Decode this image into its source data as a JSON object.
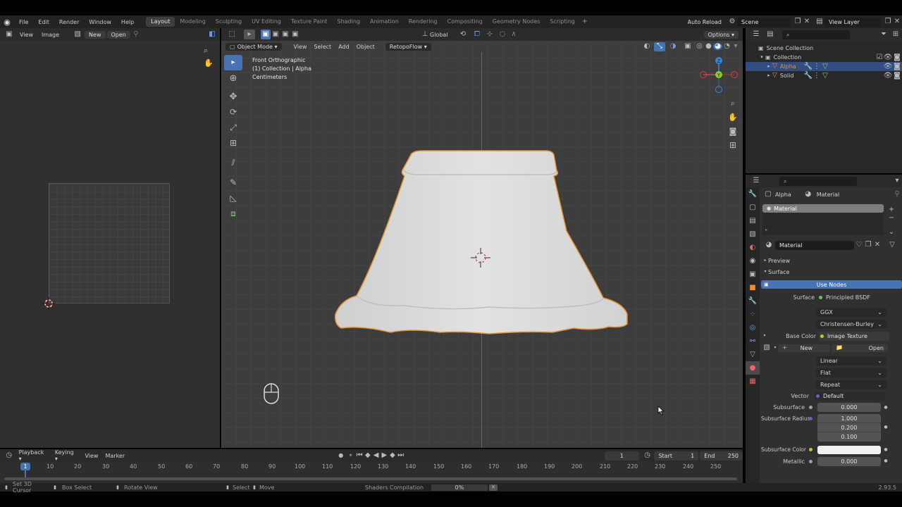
{
  "topbar": {
    "menus": [
      "File",
      "Edit",
      "Render",
      "Window",
      "Help"
    ],
    "workspaces": [
      "Layout",
      "Modeling",
      "Sculpting",
      "UV Editing",
      "Texture Paint",
      "Shading",
      "Animation",
      "Rendering",
      "Compositing",
      "Geometry Nodes",
      "Scripting"
    ],
    "active_workspace": "Layout",
    "auto_reload": "Auto Reload",
    "scene": "Scene",
    "view_layer": "View Layer"
  },
  "image_editor": {
    "menus": [
      "View",
      "Image"
    ],
    "new_label": "New",
    "open_label": "Open"
  },
  "viewport": {
    "header": {
      "transform_orientation": "Global",
      "options_label": "Options",
      "mode": "Object Mode",
      "menus": [
        "View",
        "Select",
        "Add",
        "Object"
      ],
      "addon_menu": "RetopoFlow"
    },
    "overlay_text": {
      "view_name": "Front Orthographic",
      "collection": "(1) Collection | Alpha",
      "units": "Centimeters"
    },
    "gizmo_axes": [
      "X",
      "Y",
      "Z"
    ]
  },
  "outliner": {
    "root": "Scene Collection",
    "collection": "Collection",
    "objects": [
      {
        "name": "Alpha",
        "selected": true
      },
      {
        "name": "Solid",
        "selected": false
      }
    ]
  },
  "properties": {
    "breadcrumb": {
      "object": "Alpha",
      "material": "Material"
    },
    "slot_name": "Material",
    "material_name": "Material",
    "sections": {
      "preview": "Preview",
      "surface": "Surface"
    },
    "use_nodes_label": "Use Nodes",
    "surface_label": "Surface",
    "surface_value": "Principled BSDF",
    "distribution": "GGX",
    "subsurface_method": "Christensen-Burley",
    "base_color_label": "Base Color",
    "base_color_value": "Image Texture",
    "tex_new": "New",
    "tex_open": "Open",
    "interpolation": "Linear",
    "projection": "Flat",
    "extension": "Repeat",
    "vector_label": "Vector",
    "vector_value": "Default",
    "subsurface_label": "Subsurface",
    "subsurface_value": "0.000",
    "subsurface_radius_label": "Subsurface Radius",
    "subsurface_radius_values": [
      "1.000",
      "0.200",
      "0.100"
    ],
    "subsurface_color_label": "Subsurface Color",
    "metallic_label": "Metallic",
    "metallic_value": "0.000"
  },
  "timeline": {
    "menus": [
      "Playback",
      "Keying",
      "View",
      "Marker"
    ],
    "current_frame": "1",
    "start_label": "Start",
    "start_value": "1",
    "end_label": "End",
    "end_value": "250",
    "ruler": [
      "1",
      "10",
      "20",
      "30",
      "40",
      "50",
      "60",
      "70",
      "80",
      "90",
      "100",
      "110",
      "120",
      "130",
      "140",
      "150",
      "160",
      "170",
      "180",
      "190",
      "200",
      "210",
      "220",
      "230",
      "240",
      "250"
    ]
  },
  "statusbar": {
    "hints": [
      "Set 3D Cursor",
      "Box Select",
      "Rotate View",
      "Select",
      "Move"
    ],
    "task": "Shaders Compilation",
    "progress": "0%",
    "version": "2.93.5"
  },
  "colors": {
    "accent": "#4772b3",
    "selection_outline": "#e8902e",
    "axis_x": "#e5384e",
    "axis_y": "#8bcc24",
    "axis_z": "#2e8ae6"
  }
}
